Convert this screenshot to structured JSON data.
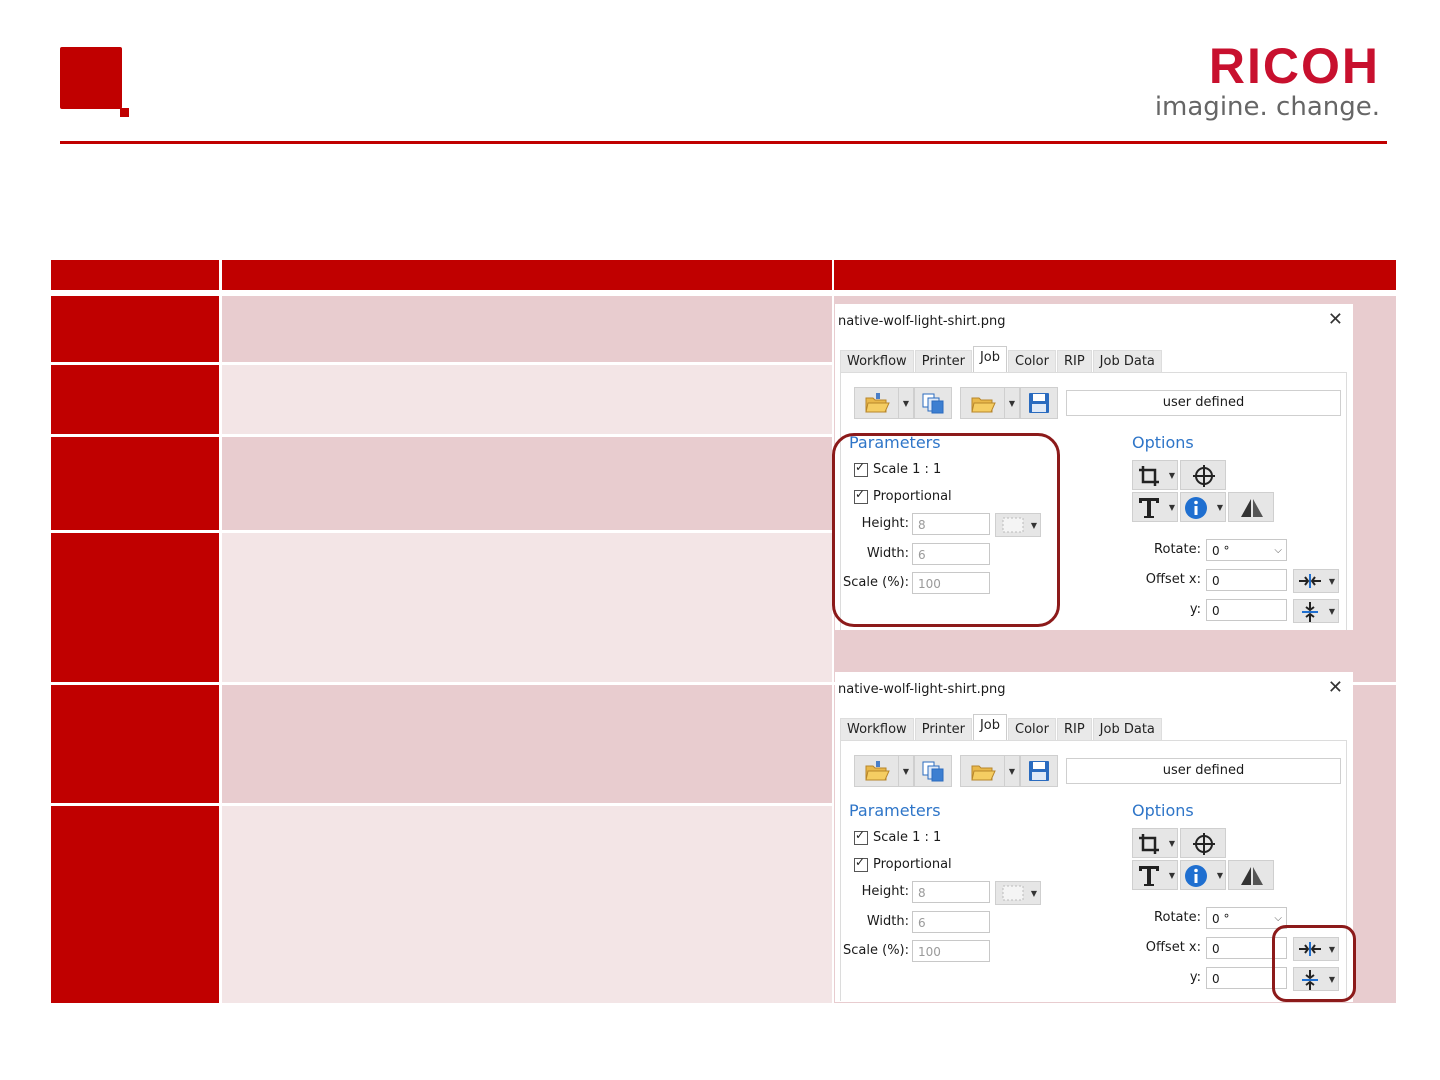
{
  "brand": {
    "name": "RICOH",
    "tagline": "imagine. change."
  },
  "colors": {
    "brand_red": "#c00000",
    "link_blue": "#2e75c8",
    "row_shade_a": "#e8cccf",
    "row_shade_b": "#f3e5e6"
  },
  "dialog": {
    "filename": "native-wolf-light-shirt.png",
    "close_glyph": "✕",
    "tabs": [
      "Workflow",
      "Printer",
      "Job",
      "Color",
      "RIP",
      "Job Data"
    ],
    "active_tab": "Job",
    "preset": "user defined",
    "parameters": {
      "heading": "Parameters",
      "scale_1_1": "Scale 1 : 1",
      "proportional": "Proportional",
      "height_label": "Height:",
      "height_value": "8",
      "width_label": "Width:",
      "width_value": "6",
      "scale_label": "Scale (%):",
      "scale_value": "100"
    },
    "options": {
      "heading": "Options",
      "rotate_label": "Rotate:",
      "rotate_value": "0 °",
      "offset_x_label": "Offset x:",
      "offset_x_value": "0",
      "offset_y_label": "y:",
      "offset_y_value": "0"
    },
    "icons": [
      "open-folder-icon",
      "copy-pages-icon",
      "folder-icon",
      "save-icon",
      "crop-icon",
      "crosshair-icon",
      "text-icon",
      "info-icon",
      "mirror-icon",
      "center-horizontal-icon",
      "center-vertical-icon"
    ]
  }
}
